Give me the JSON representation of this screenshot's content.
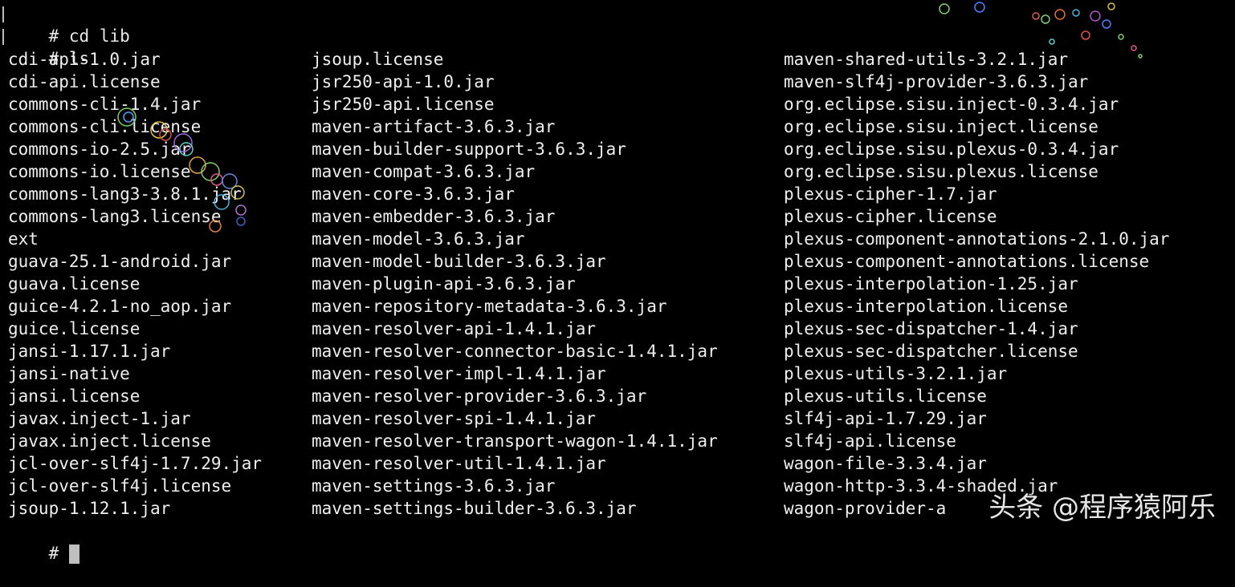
{
  "terminal": {
    "commands": [
      {
        "prompt": "#",
        "text": "cd lib"
      },
      {
        "prompt": "#",
        "text": "ls"
      }
    ],
    "listing": {
      "column1": [
        "cdi-api-1.0.jar",
        "cdi-api.license",
        "commons-cli-1.4.jar",
        "commons-cli.license",
        "commons-io-2.5.jar",
        "commons-io.license",
        "commons-lang3-3.8.1.jar",
        "commons-lang3.license",
        "ext",
        "guava-25.1-android.jar",
        "guava.license",
        "guice-4.2.1-no_aop.jar",
        "guice.license",
        "jansi-1.17.1.jar",
        "jansi-native",
        "jansi.license",
        "javax.inject-1.jar",
        "javax.inject.license",
        "jcl-over-slf4j-1.7.29.jar",
        "jcl-over-slf4j.license",
        "jsoup-1.12.1.jar"
      ],
      "column2": [
        "jsoup.license",
        "jsr250-api-1.0.jar",
        "jsr250-api.license",
        "maven-artifact-3.6.3.jar",
        "maven-builder-support-3.6.3.jar",
        "maven-compat-3.6.3.jar",
        "maven-core-3.6.3.jar",
        "maven-embedder-3.6.3.jar",
        "maven-model-3.6.3.jar",
        "maven-model-builder-3.6.3.jar",
        "maven-plugin-api-3.6.3.jar",
        "maven-repository-metadata-3.6.3.jar",
        "maven-resolver-api-1.4.1.jar",
        "maven-resolver-connector-basic-1.4.1.jar",
        "maven-resolver-impl-1.4.1.jar",
        "maven-resolver-provider-3.6.3.jar",
        "maven-resolver-spi-1.4.1.jar",
        "maven-resolver-transport-wagon-1.4.1.jar",
        "maven-resolver-util-1.4.1.jar",
        "maven-settings-3.6.3.jar",
        "maven-settings-builder-3.6.3.jar"
      ],
      "column3": [
        "maven-shared-utils-3.2.1.jar",
        "maven-slf4j-provider-3.6.3.jar",
        "org.eclipse.sisu.inject-0.3.4.jar",
        "org.eclipse.sisu.inject.license",
        "org.eclipse.sisu.plexus-0.3.4.jar",
        "org.eclipse.sisu.plexus.license",
        "plexus-cipher-1.7.jar",
        "plexus-cipher.license",
        "plexus-component-annotations-2.1.0.jar",
        "plexus-component-annotations.license",
        "plexus-interpolation-1.25.jar",
        "plexus-interpolation.license",
        "plexus-sec-dispatcher-1.4.jar",
        "plexus-sec-dispatcher.license",
        "plexus-utils-3.2.1.jar",
        "plexus-utils.license",
        "slf4j-api-1.7.29.jar",
        "slf4j-api.license",
        "wagon-file-3.3.4.jar",
        "wagon-http-3.3.4-shaded.jar",
        "wagon-provider-a"
      ]
    },
    "final_prompt": "#"
  },
  "watermark": "头条 @程序猿阿乐",
  "colors": {
    "background": "#000000",
    "text": "#e8e8e8",
    "cursor": "#bfbfbf"
  }
}
